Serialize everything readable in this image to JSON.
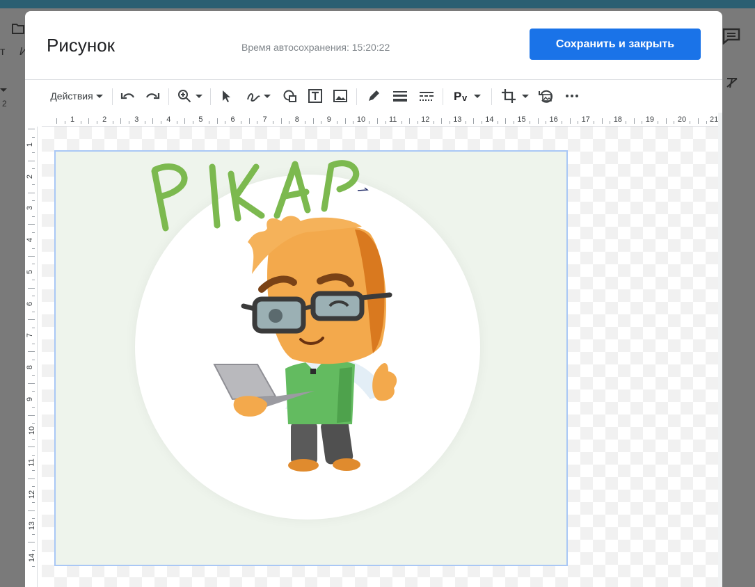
{
  "background": {
    "fragments": [
      "т",
      "И",
      "2"
    ]
  },
  "dialog": {
    "title": "Рисунок",
    "autosave": "Время автосохранения: 15:20:22",
    "save_button": "Сохранить и закрыть"
  },
  "toolbar": {
    "actions_label": "Действия",
    "icons": [
      "undo-icon",
      "redo-icon",
      "zoom-icon",
      "select-icon",
      "line-icon",
      "shape-icon",
      "textbox-icon",
      "image-icon",
      "pen-icon",
      "line-weight-icon",
      "line-dash-icon",
      "word-art-icon",
      "crop-icon",
      "reset-image-icon",
      "more-icon"
    ]
  },
  "ruler": {
    "horizontal": [
      "1",
      "2",
      "3",
      "4",
      "5",
      "6",
      "7",
      "8",
      "9",
      "10",
      "11",
      "12",
      "13",
      "14",
      "15",
      "16",
      "17",
      "18",
      "19",
      "20",
      "21"
    ],
    "vertical": [
      "1",
      "2",
      "3",
      "4",
      "5",
      "6",
      "7",
      "8",
      "9",
      "10",
      "11",
      "12",
      "13",
      "14"
    ]
  },
  "drawing": {
    "text": "PIKAP",
    "accent_green": "#7cb94f",
    "shirt_green": "#63bb60",
    "skin_orange": "#f3a94c"
  },
  "colors": {
    "primary": "#1a73e8",
    "selection": "#a9c7f5"
  }
}
